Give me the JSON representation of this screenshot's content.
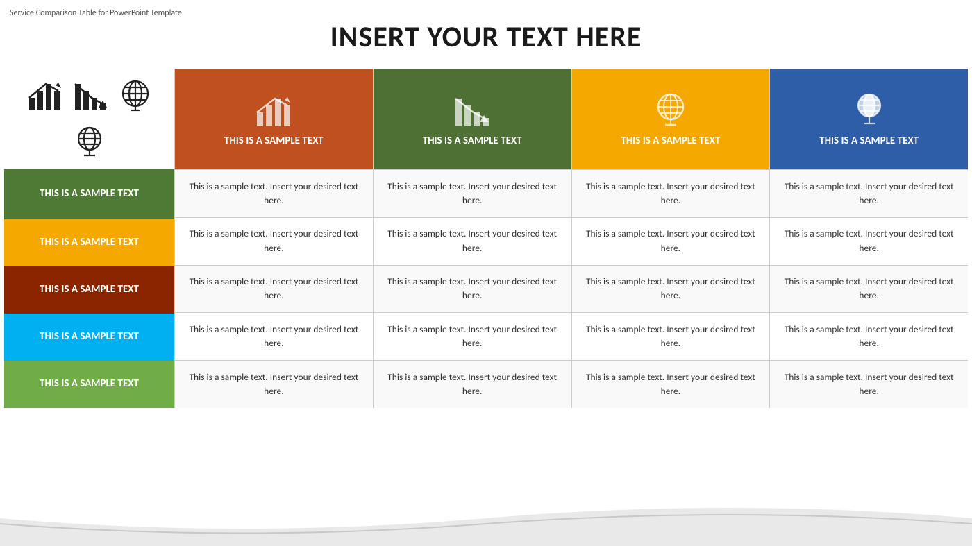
{
  "watermark": "Service Comparison Table for PowerPoint Template",
  "title": "INSERT YOUR TEXT HERE",
  "columns": [
    {
      "id": "col1",
      "header_text": "THIS IS A SAMPLE TEXT",
      "header_class": "col-header-orange",
      "icon_type": "bar-chart-up"
    },
    {
      "id": "col2",
      "header_text": "THIS IS A SAMPLE TEXT",
      "header_class": "col-header-dkgreen",
      "icon_type": "bar-chart-down"
    },
    {
      "id": "col3",
      "header_text": "THIS IS A SAMPLE TEXT",
      "header_class": "col-header-yellow",
      "icon_type": "globe-outline"
    },
    {
      "id": "col4",
      "header_text": "THIS IS A SAMPLE TEXT",
      "header_class": "col-header-blue",
      "icon_type": "globe-stand"
    }
  ],
  "rows": [
    {
      "label": "THIS IS A SAMPLE TEXT",
      "label_class": "row-label-green row-h1",
      "cell_text": "This is a sample text. Insert your desired text here."
    },
    {
      "label": "THIS IS A SAMPLE TEXT",
      "label_class": "row-label-yellow row-h2",
      "cell_text": "This is a sample text. Insert your desired text here."
    },
    {
      "label": "THIS IS A SAMPLE TEXT",
      "label_class": "row-label-darkred row-h3",
      "cell_text": "This is a sample text. Insert your desired text here."
    },
    {
      "label": "THIS IS A SAMPLE TEXT",
      "label_class": "row-label-cyan row-h4",
      "cell_text": "This is a sample text. Insert your desired text here."
    },
    {
      "label": "THIS IS A SAMPLE TEXT",
      "label_class": "row-label-lightgreen row-h5",
      "cell_text": "This is a sample text. Insert your desired text here."
    }
  ],
  "top_icons": [
    {
      "type": "bar-chart-small",
      "label": "bar chart icon 1"
    },
    {
      "type": "bar-chart-small-down",
      "label": "bar chart icon 2"
    },
    {
      "type": "globe-filled",
      "label": "globe icon 1"
    },
    {
      "type": "globe-stand-small",
      "label": "globe icon 2"
    }
  ]
}
